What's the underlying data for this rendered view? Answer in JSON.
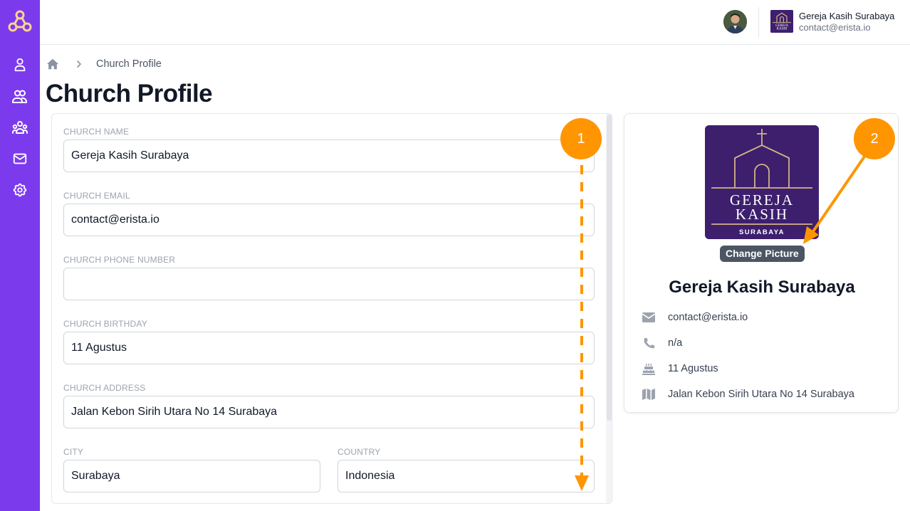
{
  "sidebar": {
    "brand_color": "#7c3aed",
    "logo_icon": "community-logo-icon",
    "items": [
      {
        "name": "profile",
        "icon": "user-icon"
      },
      {
        "name": "members",
        "icon": "users-icon"
      },
      {
        "name": "groups",
        "icon": "user-group-icon"
      },
      {
        "name": "messages",
        "icon": "mail-icon"
      },
      {
        "name": "settings",
        "icon": "gear-icon"
      }
    ]
  },
  "topbar": {
    "account_name": "Gereja Kasih Surabaya",
    "account_email": "contact@erista.io"
  },
  "breadcrumb": {
    "home_icon": "home-icon",
    "current": "Church Profile"
  },
  "page_title": "Church Profile",
  "form": {
    "church_name": {
      "label": "Church Name",
      "value": "Gereja Kasih Surabaya"
    },
    "church_email": {
      "label": "Church Email",
      "value": "contact@erista.io"
    },
    "church_phone": {
      "label": "Church Phone Number",
      "value": ""
    },
    "church_birthday": {
      "label": "Church Birthday",
      "value": "11 Agustus"
    },
    "church_address": {
      "label": "Church Address",
      "value": "Jalan Kebon Sirih Utara No 14 Surabaya"
    },
    "city": {
      "label": "City",
      "value": "Surabaya"
    },
    "country": {
      "label": "Country",
      "value": "Indonesia"
    }
  },
  "profile": {
    "logo_text_1": "GEREJA",
    "logo_text_2": "KASIH",
    "logo_text_3": "SURABAYA",
    "change_picture_label": "Change Picture",
    "name": "Gereja Kasih Surabaya",
    "email": "contact@erista.io",
    "phone": "n/a",
    "birthday": "11 Agustus",
    "address": "Jalan Kebon Sirih Utara No 14 Surabaya"
  },
  "annotations": {
    "color": "#ff9500",
    "step_1": "1",
    "step_2": "2"
  }
}
